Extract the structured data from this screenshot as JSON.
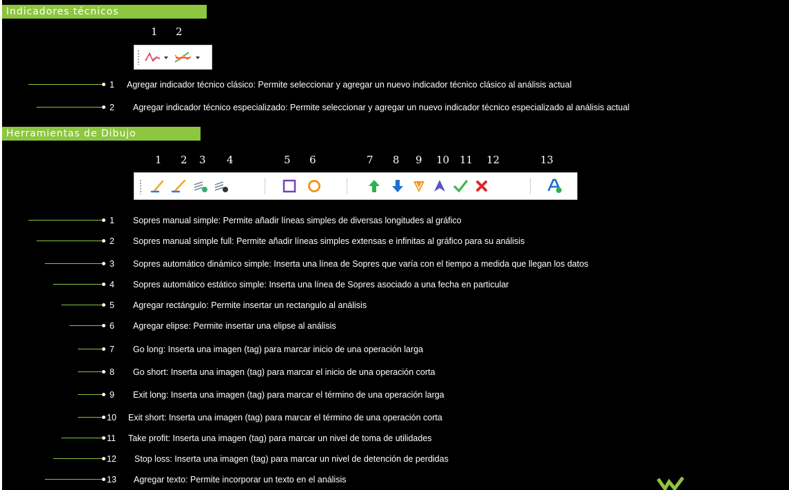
{
  "sections": {
    "indicadores": {
      "title": "Indicadores técnicos",
      "labels": [
        "1",
        "2"
      ],
      "items": [
        {
          "num": "1",
          "text": "Agregar  indicador técnico clásico: Permite seleccionar y agregar un nuevo indicador técnico clásico al análisis actual"
        },
        {
          "num": "2",
          "text": "Agregar indicador técnico  especializado: Permite seleccionar y agregar un nuevo indicador técnico especializado al análisis actual"
        }
      ]
    },
    "dibujo": {
      "title": "Herramientas  de  Dibujo",
      "labels": [
        "1",
        "2",
        "3",
        "4",
        "5",
        "6",
        "7",
        "8",
        "9",
        "10",
        "11",
        "12",
        "13"
      ],
      "items": [
        {
          "num": "1",
          "text": "Sopres manual simple: Permite añadir líneas simples de diversas longitudes al gráfico"
        },
        {
          "num": "2",
          "text": "Sopres manual simple full: Permite añadir líneas simples extensas e infinitas al gráfico para su análisis"
        },
        {
          "num": "3",
          "text": "Sopres automático dinámico simple: Inserta una línea de Sopres que varía con el tiempo a medida que llegan los datos"
        },
        {
          "num": "4",
          "text": "Sopres automático estático simple: Inserta una línea de Sopres asociado a una fecha en particular"
        },
        {
          "num": "5",
          "text": "Agregar rectángulo: Permite insertar un rectangulo al análisis"
        },
        {
          "num": "6",
          "text": "Agregar elipse: Permite insertar una elipse al análisis"
        },
        {
          "num": "7",
          "text": "Go long: Inserta una imagen (tag) para marcar inicio de una operación larga"
        },
        {
          "num": "8",
          "text": "Go short: Inserta una imagen (tag) para marcar el inicio de una operación corta"
        },
        {
          "num": "9",
          "text": "Exit long: Inserta una imagen (tag) para marcar el término de una operación larga"
        },
        {
          "num": "10",
          "text": "Exit short: Inserta una imagen (tag) para marcar el término de una operación corta"
        },
        {
          "num": "11",
          "text": "Take profit: Inserta una imagen (tag) para marcar un nivel de toma de utilidades"
        },
        {
          "num": "12",
          "text": "Stop loss: Inserta una imagen (tag) para marcar un nivel de detención de perdidas"
        },
        {
          "num": "13",
          "text": "Agregar texto: Permite incorporar un texto en el análisis"
        }
      ]
    }
  },
  "toolbar_indicadores": {
    "buttons": [
      {
        "icon": "classic-indicator-icon",
        "has_dropdown": true
      },
      {
        "icon": "specialized-indicator-icon",
        "has_dropdown": true
      }
    ]
  },
  "toolbar_dibujo": {
    "buttons": [
      {
        "icon": "manual-line-icon"
      },
      {
        "icon": "manual-line-full-icon"
      },
      {
        "icon": "auto-dynamic-line-icon"
      },
      {
        "icon": "auto-static-line-icon"
      },
      {
        "icon": "rectangle-icon"
      },
      {
        "icon": "ellipse-icon"
      },
      {
        "icon": "go-long-icon"
      },
      {
        "icon": "go-short-icon"
      },
      {
        "icon": "exit-long-icon"
      },
      {
        "icon": "exit-short-icon"
      },
      {
        "icon": "take-profit-icon"
      },
      {
        "icon": "stop-loss-icon"
      },
      {
        "icon": "add-text-icon"
      }
    ]
  },
  "colors": {
    "accent": "#8dc63f",
    "background": "#000000",
    "text": "#ffffff",
    "rect_orange": "#f7941d",
    "arrow_green": "#2bb24c",
    "arrow_blue": "#1f6fd1",
    "stop_red": "#e0262c",
    "exit_purple": "#5b54c9"
  }
}
